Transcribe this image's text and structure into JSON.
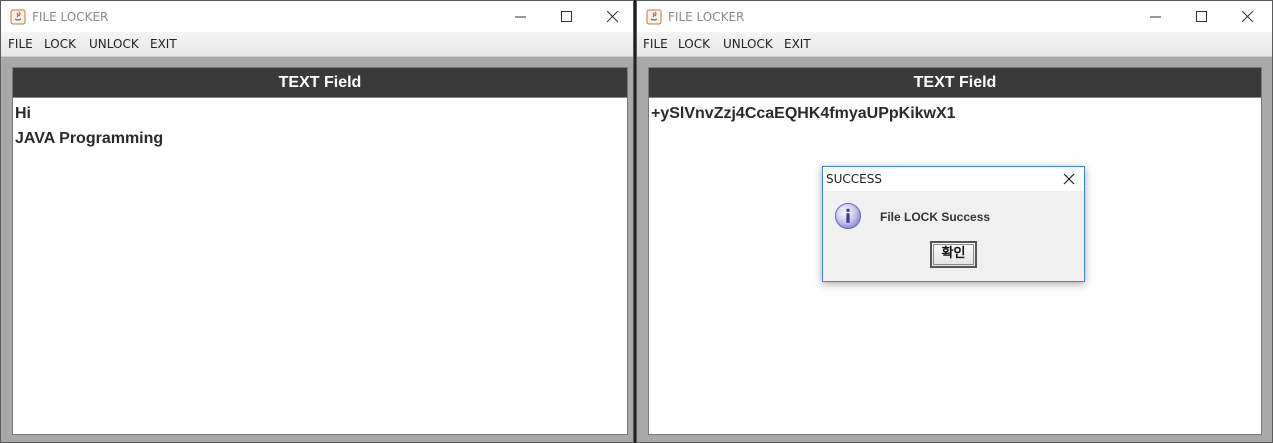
{
  "left_window": {
    "title": "FILE LOCKER",
    "menu": [
      "FILE",
      "LOCK",
      "UNLOCK",
      "EXIT"
    ],
    "panel_title": "TEXT Field",
    "text_lines": [
      "Hi",
      "JAVA Programming"
    ]
  },
  "right_window": {
    "title": "FILE LOCKER",
    "menu": [
      "FILE",
      "LOCK",
      "UNLOCK",
      "EXIT"
    ],
    "panel_title": "TEXT Field",
    "text_lines": [
      "+ySlVnvZzj4CcaEQHK4fmyaUPpKikwX1"
    ]
  },
  "dialog": {
    "title": "SUCCESS",
    "message": "File LOCK Success",
    "ok_label": "확인",
    "icon": "info-icon"
  },
  "colors": {
    "panel_header_bg": "#3a3a3a",
    "window_bg": "#a8a8a8",
    "dialog_border": "#3a86d6"
  }
}
